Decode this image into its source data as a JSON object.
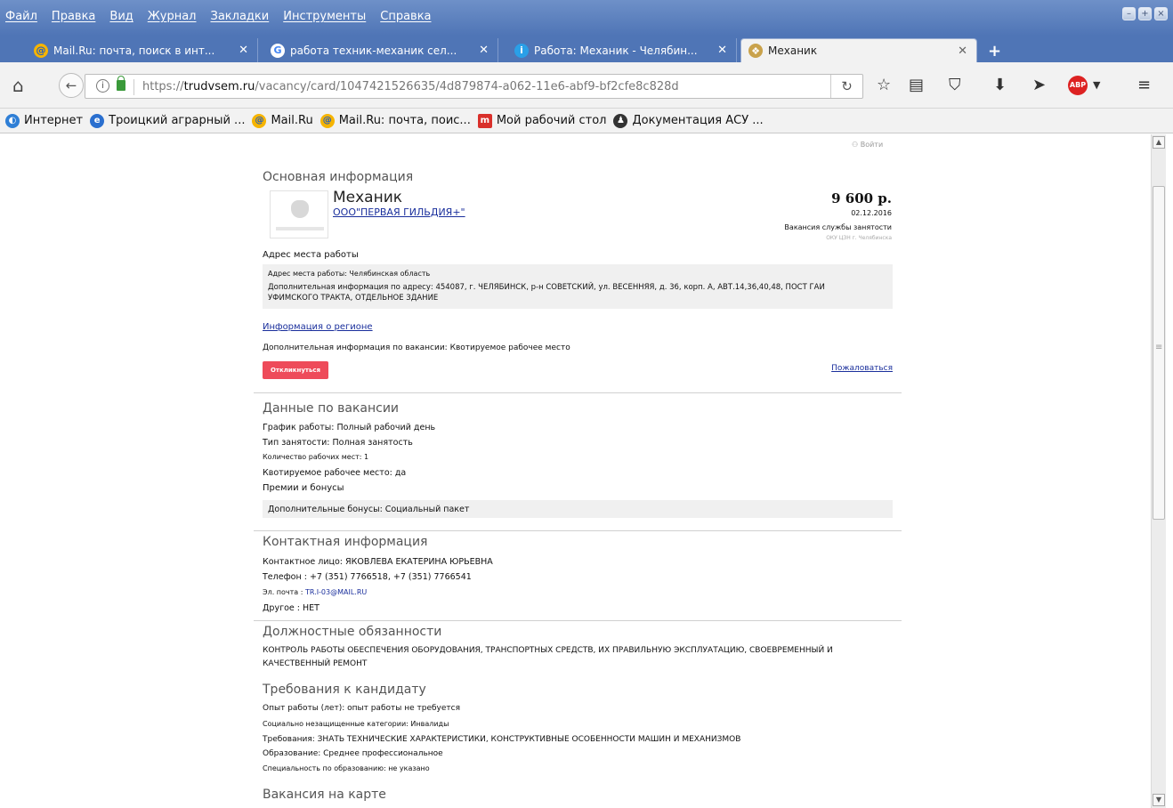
{
  "menubar": {
    "items": [
      "Файл",
      "Правка",
      "Вид",
      "Журнал",
      "Закладки",
      "Инструменты",
      "Справка"
    ]
  },
  "tabs": [
    {
      "title": "Mail.Ru: почта, поиск в инт...",
      "icon": "mailru-icon",
      "active": false
    },
    {
      "title": "работа техник-механик сел...",
      "icon": "google-icon",
      "active": false
    },
    {
      "title": "Работа: Механик - Челябин...",
      "icon": "info-icon",
      "active": false
    },
    {
      "title": "Механик",
      "icon": "emblem-icon",
      "active": true
    }
  ],
  "url": {
    "prefix": "https://",
    "domain": "trudvsem.ru",
    "path": "/vacancy/card/1047421526635/4d879874-a062-11e6-abf9-bf2cfe8c828d"
  },
  "bookmarks": [
    "Интернет",
    "Троицкий аграрный ...",
    "Mail.Ru",
    "Mail.Ru: почта, поис...",
    "Мой рабочий стол",
    "Документация АСУ ..."
  ],
  "page": {
    "login": "Войти",
    "main_info": {
      "heading": "Основная информация",
      "job_title": "Механик",
      "company": "ООО\"ПЕРВАЯ ГИЛЬДИЯ+\"",
      "salary": "9 600 р.",
      "date": "02.12.2016",
      "source": "Вакансия службы занятости",
      "source_org": "ОКУ ЦЗН г. Челябинска",
      "address_label": "Адрес места работы",
      "address_line1": "Адрес места работы: Челябинская область",
      "address_line2": "Дополнительная информация по адресу: 454087, г. ЧЕЛЯБИНСК, р-н СОВЕТСКИЙ, ул. ВЕСЕННЯЯ, д. 36, корп. А, АВТ.14,36,40,48, ПОСТ ГАИ",
      "address_line3": "УФИМСКОГО ТРАКТА, ОТДЕЛЬНОЕ ЗДАНИЕ",
      "region_link": "Информация о регионе",
      "extra_info": "Дополнительная информация по вакансии: Квотируемое рабочее место",
      "respond_button": "Откликнуться",
      "complain_link": "Пожаловаться"
    },
    "vacancy_data": {
      "heading": "Данные по вакансии",
      "schedule": "График работы: Полный рабочий день",
      "employment": "Тип занятости: Полная занятость",
      "places": "Количество рабочих мест: 1",
      "quota": "Квотируемое рабочее место: да",
      "bonuses_heading": "Премии и бонусы",
      "bonuses": "Дополнительные бонусы: Социальный пакет"
    },
    "contacts": {
      "heading": "Контактная информация",
      "person": "Контактное лицо: ЯКОВЛЕВА ЕКАТЕРИНА ЮРЬЕВНА",
      "phone": "Телефон : +7 (351) 7766518, +7 (351) 7766541",
      "email_label": "Эл. почта : ",
      "email": "TR.I-03@MAIL.RU",
      "other": "Другое : НЕТ"
    },
    "duties": {
      "heading": "Должностные обязанности",
      "line1": "КОНТРОЛЬ РАБОТЫ ОБЕСПЕЧЕНИЯ ОБОРУДОВАНИЯ, ТРАНСПОРТНЫХ СРЕДСТВ, ИХ ПРАВИЛЬНУЮ ЭКСПЛУАТАЦИЮ, СВОЕВРЕМЕННЫЙ И",
      "line2": "КАЧЕСТВЕННЫЙ РЕМОНТ"
    },
    "requirements": {
      "heading": "Требования к кандидату",
      "experience": "Опыт работы (лет): опыт работы не требуется",
      "category": "Социально незащищенные категории: Инвалиды",
      "reqs": "Требования: ЗНАТЬ ТЕХНИЧЕСКИЕ ХАРАКТЕРИСТИКИ, КОНСТРУКТИВНЫЕ ОСОБЕННОСТИ МАШИН И МЕХАНИЗМОВ",
      "education": "Образование: Среднее профессиональное",
      "specialty": "Специальность по образованию: не указано"
    },
    "map_heading": "Вакансия на карте"
  }
}
